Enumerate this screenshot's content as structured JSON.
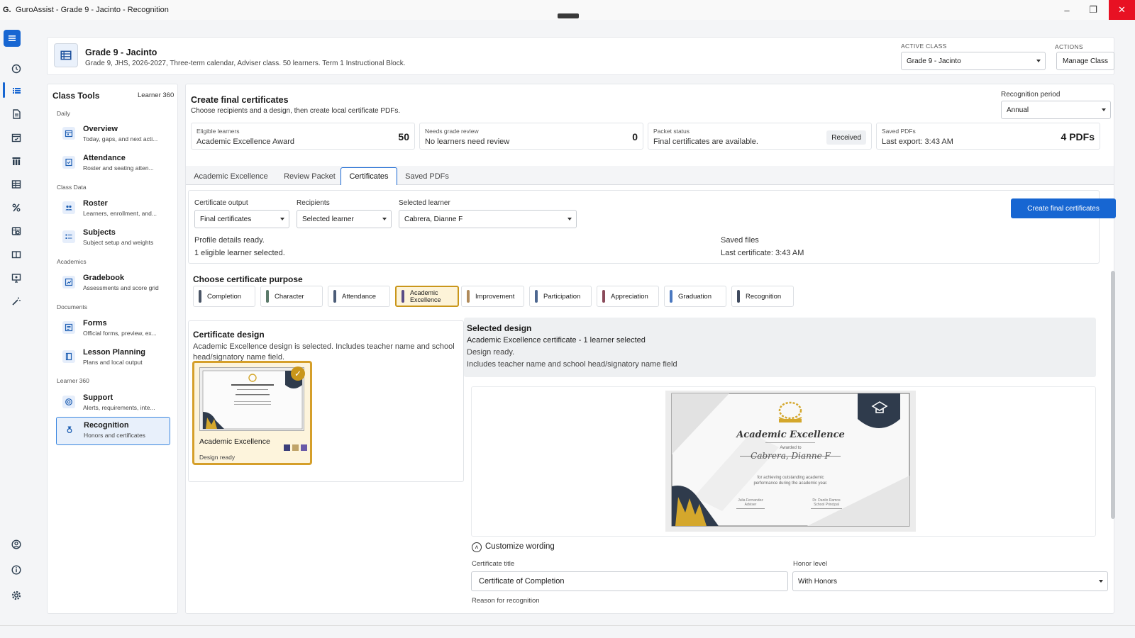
{
  "window": {
    "title": "GuroAssist - Grade 9 - Jacinto - Recognition",
    "logo": "G."
  },
  "header": {
    "title": "Grade 9 - Jacinto",
    "subtitle": "Grade 9, JHS, 2026-2027, Three-term calendar, Adviser class. 50 learners. Term 1 Instructional Block.",
    "active_class_label": "ACTIVE CLASS",
    "active_class_value": "Grade 9 - Jacinto",
    "actions_label": "ACTIONS",
    "manage_class": "Manage Class"
  },
  "sidebar": {
    "title": "Class Tools",
    "learner_link": "Learner 360",
    "groups": [
      "Daily",
      "Class Data",
      "Academics",
      "Documents",
      "Learner 360"
    ],
    "items": [
      {
        "label": "Overview",
        "sub": "Today, gaps, and next acti...",
        "icon": "calendar-icon"
      },
      {
        "label": "Attendance",
        "sub": "Roster and seating atten...",
        "icon": "attendance-icon"
      },
      {
        "label": "Roster",
        "sub": "Learners, enrollment, and...",
        "icon": "people-icon"
      },
      {
        "label": "Subjects",
        "sub": "Subject setup and weights",
        "icon": "list-icon"
      },
      {
        "label": "Gradebook",
        "sub": "Assessments and score grid",
        "icon": "chart-icon"
      },
      {
        "label": "Forms",
        "sub": "Official forms, preview, ex...",
        "icon": "form-icon"
      },
      {
        "label": "Lesson Planning",
        "sub": "Plans and local output",
        "icon": "book-icon"
      },
      {
        "label": "Support",
        "sub": "Alerts, requirements, inte...",
        "icon": "support-icon"
      },
      {
        "label": "Recognition",
        "sub": "Honors and certificates",
        "icon": "medal-icon"
      }
    ]
  },
  "main": {
    "title": "Create final certificates",
    "subtitle": "Choose recipients and a design, then create local certificate PDFs.",
    "period_label": "Recognition period",
    "period_value": "Annual",
    "stats": [
      {
        "label": "Eligible learners",
        "value": "Academic Excellence Award",
        "number": "50"
      },
      {
        "label": "Needs grade review",
        "value": "No learners need review",
        "number": "0"
      },
      {
        "label": "Packet status",
        "value": "Final certificates are available.",
        "badge": "Received"
      },
      {
        "label": "Saved PDFs",
        "value": "Last export: 3:43 AM",
        "number": "4 PDFs"
      }
    ],
    "tabs": [
      "Academic Excellence",
      "Review Packet",
      "Certificates",
      "Saved PDFs"
    ],
    "active_tab": "Certificates"
  },
  "form": {
    "output_label": "Certificate output",
    "output_value": "Final certificates",
    "recipients_label": "Recipients",
    "recipients_value": "Selected learner",
    "learner_label": "Selected learner",
    "learner_value": "Cabrera, Dianne F",
    "create_button": "Create final certificates",
    "profile_ready": "Profile details ready.",
    "eligible_selected": "1 eligible learner selected.",
    "saved_files_label": "Saved files",
    "last_certificate": "Last certificate: 3:43 AM"
  },
  "purpose": {
    "title": "Choose certificate purpose",
    "chips": [
      {
        "label": "Completion",
        "color": "#4a5566"
      },
      {
        "label": "Character",
        "color": "#5b7a6a"
      },
      {
        "label": "Attendance",
        "color": "#4b5c78"
      },
      {
        "label": "Academic Excellence",
        "color": "#5a4c86"
      },
      {
        "label": "Improvement",
        "color": "#b08a5a"
      },
      {
        "label": "Participation",
        "color": "#4d6790"
      },
      {
        "label": "Appreciation",
        "color": "#8a4a5a"
      },
      {
        "label": "Graduation",
        "color": "#4a78c0"
      },
      {
        "label": "Recognition",
        "color": "#3f4a5e"
      }
    ],
    "selected": "Academic Excellence"
  },
  "design": {
    "title": "Certificate design",
    "description": "Academic Excellence design is selected. Includes teacher name and school head/signatory name field.",
    "card_name": "Academic Excellence",
    "card_status": "Design ready",
    "swatches": [
      "#3b3f7a",
      "#c0a46a",
      "#6a5aa8"
    ]
  },
  "selected_design": {
    "title": "Selected design",
    "line1": "Academic Excellence certificate - 1 learner selected",
    "line2": "Design ready.",
    "line3": "Includes teacher name and school head/signatory name field"
  },
  "certificate": {
    "heading": "Academic Excellence",
    "awarded_to": "Awarded to",
    "name": "Cabrera, Dianne F",
    "reason1": "for achieving outstanding academic",
    "reason2": "performance during the academic year.",
    "adviser_name": "Julia Fernandez",
    "adviser_role": "Adviser",
    "principal_name": "Dr. Danilo Ramos",
    "principal_role": "School Principal",
    "gold": "#d4a72c",
    "navy": "#2f3b4c"
  },
  "wording": {
    "toggle": "Customize wording",
    "title_label": "Certificate title",
    "title_value": "Certificate of Completion",
    "honor_label": "Honor level",
    "honor_value": "With Honors",
    "reason_label": "Reason for recognition"
  }
}
